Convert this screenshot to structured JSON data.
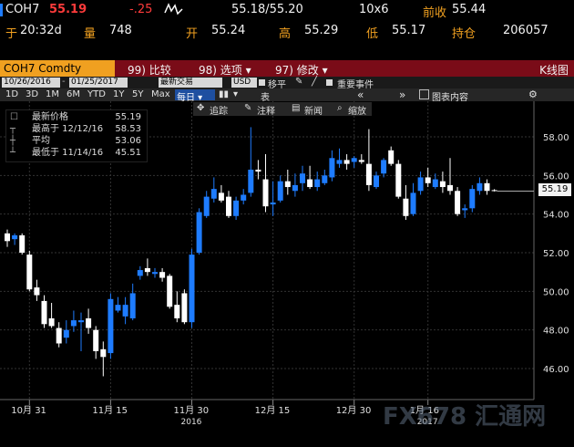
{
  "header": {
    "ticker": "COH7",
    "last": "55.19",
    "change": "-.25",
    "bid_ask": "55.18/55.20",
    "size": "10x6",
    "prev_close_label": "前收",
    "prev_close": "55.44",
    "time_prefix": "于",
    "time": "20:32d",
    "volume_label": "量",
    "volume": "748",
    "open_label": "开",
    "open": "55.24",
    "high_label": "高",
    "high": "55.29",
    "low_label": "低",
    "low": "55.17",
    "oi_label": "持仓",
    "oi": "206057"
  },
  "titlebar": {
    "security": "COH7 Comdty",
    "menu1": "99) 比较",
    "menu2": "98) 选项 ▾",
    "menu3": "97) 修改 ▾",
    "view": "K线图"
  },
  "toolbar": {
    "start_date": "10/26/2016",
    "end_date": "01/25/2017",
    "market": "最新交易",
    "currency": "USD",
    "shift": "移平",
    "events": "重要事件"
  },
  "periods": [
    "1D",
    "3D",
    "1M",
    "6M",
    "YTD",
    "1Y",
    "5Y",
    "Max"
  ],
  "freq": "每日 ▾",
  "table_icon": "表",
  "nav_back": "«",
  "nav_fwd": "»",
  "chart_content": "图表内容",
  "tools": {
    "track": "追踪",
    "annotate": "注释",
    "news": "新闻",
    "zoom": "缩放"
  },
  "legend": [
    {
      "key": "最新价格",
      "value": "55.19"
    },
    {
      "key": "最高于 12/12/16",
      "value": "58.53"
    },
    {
      "key": "平均",
      "value": "53.06"
    },
    {
      "key": "最低于 11/14/16",
      "value": "45.51"
    }
  ],
  "price_tag": "55.19",
  "watermark": "FX678 汇通网",
  "colors": {
    "up": "#1e7cff",
    "down": "#ffffff",
    "accent": "#f0a020",
    "titlebar": "#7a0c18"
  },
  "chart_data": {
    "type": "candlestick",
    "ylim": [
      44.5,
      59.5
    ],
    "yticks": [
      46,
      48,
      50,
      52,
      54,
      56,
      58
    ],
    "xticks": [
      {
        "label": "10月 31",
        "idx": 3
      },
      {
        "label": "11月 15",
        "idx": 14
      },
      {
        "label": "11月 30",
        "idx": 25
      },
      {
        "label": "12月 15",
        "idx": 36
      },
      {
        "label": "12月 30",
        "idx": 47
      },
      {
        "label": "1月 16",
        "idx": 57
      }
    ],
    "year_labels": [
      {
        "label": "2016",
        "idx": 25
      },
      {
        "label": "2017",
        "idx": 57
      }
    ],
    "candles": [
      {
        "o": 53.0,
        "h": 53.2,
        "l": 52.3,
        "c": 52.6
      },
      {
        "o": 52.7,
        "h": 53.0,
        "l": 52.4,
        "c": 52.9
      },
      {
        "o": 52.9,
        "h": 53.0,
        "l": 51.9,
        "c": 52.0
      },
      {
        "o": 51.9,
        "h": 52.1,
        "l": 50.0,
        "c": 50.1
      },
      {
        "o": 50.2,
        "h": 50.6,
        "l": 49.5,
        "c": 49.8
      },
      {
        "o": 49.5,
        "h": 49.8,
        "l": 48.1,
        "c": 48.3
      },
      {
        "o": 48.6,
        "h": 49.4,
        "l": 48.1,
        "c": 48.2
      },
      {
        "o": 48.1,
        "h": 48.4,
        "l": 47.1,
        "c": 47.3
      },
      {
        "o": 47.6,
        "h": 48.5,
        "l": 47.3,
        "c": 48.0
      },
      {
        "o": 48.2,
        "h": 49.0,
        "l": 47.9,
        "c": 48.5
      },
      {
        "o": 48.4,
        "h": 48.9,
        "l": 46.9,
        "c": 48.5
      },
      {
        "o": 48.6,
        "h": 49.1,
        "l": 47.8,
        "c": 48.1
      },
      {
        "o": 48.0,
        "h": 48.2,
        "l": 46.5,
        "c": 46.9
      },
      {
        "o": 47.0,
        "h": 47.4,
        "l": 45.6,
        "c": 46.6
      },
      {
        "o": 46.8,
        "h": 49.9,
        "l": 46.5,
        "c": 49.6
      },
      {
        "o": 49.0,
        "h": 49.7,
        "l": 48.9,
        "c": 49.3
      },
      {
        "o": 48.7,
        "h": 49.7,
        "l": 48.3,
        "c": 49.3
      },
      {
        "o": 48.6,
        "h": 50.4,
        "l": 48.5,
        "c": 49.9
      },
      {
        "o": 50.8,
        "h": 51.3,
        "l": 50.6,
        "c": 51.1
      },
      {
        "o": 51.2,
        "h": 51.7,
        "l": 50.8,
        "c": 51.0
      },
      {
        "o": 50.9,
        "h": 51.2,
        "l": 50.7,
        "c": 51.0
      },
      {
        "o": 51.0,
        "h": 51.2,
        "l": 50.5,
        "c": 50.7
      },
      {
        "o": 50.8,
        "h": 50.9,
        "l": 49.1,
        "c": 49.2
      },
      {
        "o": 49.3,
        "h": 50.0,
        "l": 48.4,
        "c": 48.6
      },
      {
        "o": 49.9,
        "h": 50.1,
        "l": 48.3,
        "c": 48.4
      },
      {
        "o": 48.4,
        "h": 52.2,
        "l": 48.1,
        "c": 51.9
      },
      {
        "o": 52.0,
        "h": 54.3,
        "l": 51.9,
        "c": 54.1
      },
      {
        "o": 53.9,
        "h": 55.2,
        "l": 53.8,
        "c": 54.9
      },
      {
        "o": 54.8,
        "h": 55.9,
        "l": 54.6,
        "c": 55.3
      },
      {
        "o": 55.1,
        "h": 55.5,
        "l": 54.6,
        "c": 54.7
      },
      {
        "o": 54.9,
        "h": 55.2,
        "l": 53.8,
        "c": 53.9
      },
      {
        "o": 53.9,
        "h": 54.9,
        "l": 53.7,
        "c": 54.7
      },
      {
        "o": 54.7,
        "h": 55.3,
        "l": 54.5,
        "c": 55.0
      },
      {
        "o": 55.1,
        "h": 58.5,
        "l": 54.9,
        "c": 56.3
      },
      {
        "o": 56.3,
        "h": 56.8,
        "l": 55.8,
        "c": 56.2
      },
      {
        "o": 55.8,
        "h": 57.1,
        "l": 54.1,
        "c": 54.4
      },
      {
        "o": 54.5,
        "h": 55.7,
        "l": 53.9,
        "c": 54.6
      },
      {
        "o": 54.7,
        "h": 56.0,
        "l": 54.6,
        "c": 55.7
      },
      {
        "o": 55.7,
        "h": 56.3,
        "l": 55.0,
        "c": 55.4
      },
      {
        "o": 55.2,
        "h": 56.1,
        "l": 54.9,
        "c": 55.5
      },
      {
        "o": 55.6,
        "h": 56.5,
        "l": 55.2,
        "c": 56.1
      },
      {
        "o": 55.8,
        "h": 56.5,
        "l": 55.3,
        "c": 55.4
      },
      {
        "o": 55.4,
        "h": 56.2,
        "l": 55.2,
        "c": 55.8
      },
      {
        "o": 55.6,
        "h": 56.3,
        "l": 55.5,
        "c": 56.0
      },
      {
        "o": 55.9,
        "h": 57.3,
        "l": 55.7,
        "c": 56.9
      },
      {
        "o": 56.6,
        "h": 57.4,
        "l": 56.4,
        "c": 56.8
      },
      {
        "o": 56.8,
        "h": 57.1,
        "l": 56.3,
        "c": 56.6
      },
      {
        "o": 56.7,
        "h": 57.0,
        "l": 56.4,
        "c": 56.9
      },
      {
        "o": 56.8,
        "h": 57.1,
        "l": 56.6,
        "c": 56.7
      },
      {
        "o": 56.6,
        "h": 58.4,
        "l": 55.2,
        "c": 55.5
      },
      {
        "o": 55.4,
        "h": 56.2,
        "l": 55.3,
        "c": 56.0
      },
      {
        "o": 56.1,
        "h": 56.9,
        "l": 55.9,
        "c": 56.8
      },
      {
        "o": 57.3,
        "h": 57.5,
        "l": 56.5,
        "c": 56.6
      },
      {
        "o": 56.6,
        "h": 56.8,
        "l": 54.8,
        "c": 54.9
      },
      {
        "o": 54.8,
        "h": 55.5,
        "l": 53.7,
        "c": 53.9
      },
      {
        "o": 54.0,
        "h": 55.6,
        "l": 53.9,
        "c": 55.1
      },
      {
        "o": 55.2,
        "h": 56.2,
        "l": 55.0,
        "c": 55.9
      },
      {
        "o": 55.9,
        "h": 56.4,
        "l": 55.4,
        "c": 55.6
      },
      {
        "o": 55.4,
        "h": 56.1,
        "l": 55.3,
        "c": 55.8
      },
      {
        "o": 55.7,
        "h": 56.2,
        "l": 55.1,
        "c": 55.4
      },
      {
        "o": 55.5,
        "h": 56.9,
        "l": 55.0,
        "c": 55.2
      },
      {
        "o": 55.2,
        "h": 55.4,
        "l": 53.9,
        "c": 54.0
      },
      {
        "o": 54.2,
        "h": 54.5,
        "l": 53.8,
        "c": 54.3
      },
      {
        "o": 54.3,
        "h": 55.5,
        "l": 54.1,
        "c": 55.3
      },
      {
        "o": 55.2,
        "h": 55.9,
        "l": 55.0,
        "c": 55.6
      },
      {
        "o": 55.6,
        "h": 55.8,
        "l": 55.0,
        "c": 55.2
      },
      {
        "o": 55.24,
        "h": 55.29,
        "l": 55.17,
        "c": 55.19
      }
    ]
  }
}
